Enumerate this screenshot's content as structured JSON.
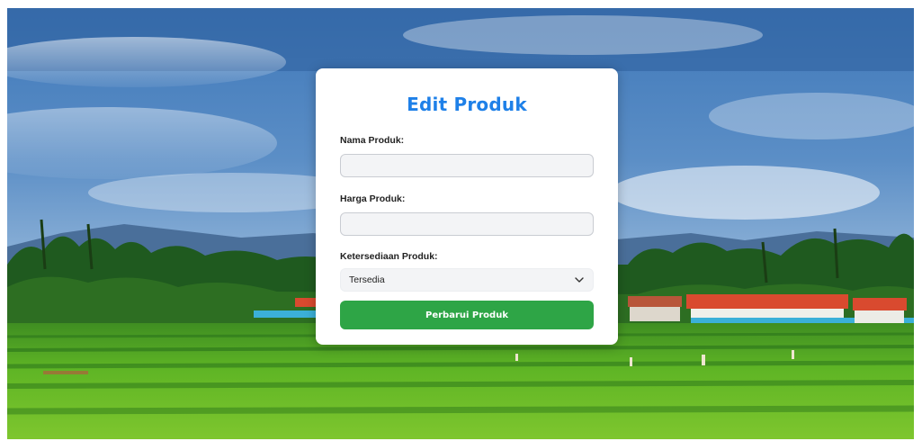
{
  "form": {
    "title": "Edit Produk",
    "name_label": "Nama Produk:",
    "name_value": "",
    "price_label": "Harga Produk:",
    "price_value": "",
    "availability_label": "Ketersediaan Produk:",
    "availability_selected": "Tersedia",
    "submit_label": "Perbarui Produk"
  },
  "colors": {
    "title": "#1e80e8",
    "button": "#2ea546",
    "input_bg": "#f3f4f6"
  },
  "background": {
    "scene": "rice-field-landscape"
  }
}
